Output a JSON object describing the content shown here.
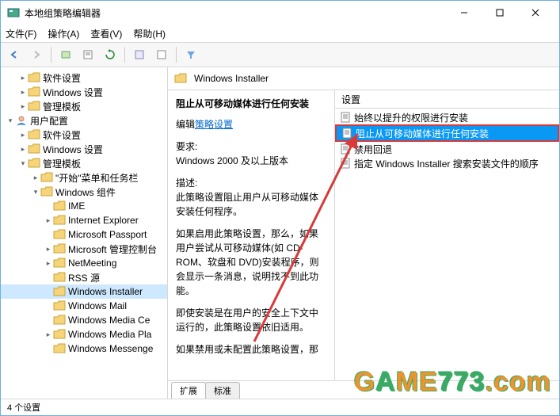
{
  "window": {
    "title": "本地组策略编辑器"
  },
  "menu": [
    "文件(F)",
    "操作(A)",
    "查看(V)",
    "帮助(H)"
  ],
  "tree": [
    {
      "d": 1,
      "exp": "r",
      "icon": "folder",
      "label": "软件设置"
    },
    {
      "d": 1,
      "exp": "r",
      "icon": "folder",
      "label": "Windows 设置"
    },
    {
      "d": 1,
      "exp": "r",
      "icon": "folder",
      "label": "管理模板"
    },
    {
      "d": 0,
      "exp": "d",
      "icon": "user",
      "label": "用户配置"
    },
    {
      "d": 1,
      "exp": "r",
      "icon": "folder",
      "label": "软件设置"
    },
    {
      "d": 1,
      "exp": "r",
      "icon": "folder",
      "label": "Windows 设置"
    },
    {
      "d": 1,
      "exp": "d",
      "icon": "folder",
      "label": "管理模板"
    },
    {
      "d": 2,
      "exp": "r",
      "icon": "folder",
      "label": "\"开始\"菜单和任务栏"
    },
    {
      "d": 2,
      "exp": "d",
      "icon": "folder",
      "label": "Windows 组件"
    },
    {
      "d": 3,
      "exp": "",
      "icon": "folder",
      "label": "IME"
    },
    {
      "d": 3,
      "exp": "r",
      "icon": "folder",
      "label": "Internet Explorer"
    },
    {
      "d": 3,
      "exp": "",
      "icon": "folder",
      "label": "Microsoft Passport"
    },
    {
      "d": 3,
      "exp": "r",
      "icon": "folder",
      "label": "Microsoft 管理控制台"
    },
    {
      "d": 3,
      "exp": "r",
      "icon": "folder",
      "label": "NetMeeting"
    },
    {
      "d": 3,
      "exp": "",
      "icon": "folder",
      "label": "RSS 源"
    },
    {
      "d": 3,
      "exp": "",
      "icon": "folder",
      "label": "Windows Installer",
      "sel": true
    },
    {
      "d": 3,
      "exp": "",
      "icon": "folder",
      "label": "Windows Mail"
    },
    {
      "d": 3,
      "exp": "",
      "icon": "folder",
      "label": "Windows Media Ce"
    },
    {
      "d": 3,
      "exp": "r",
      "icon": "folder",
      "label": "Windows Media Pla"
    },
    {
      "d": 3,
      "exp": "",
      "icon": "folder",
      "label": "Windows Messenge"
    }
  ],
  "rightHeader": "Windows Installer",
  "desc": {
    "title": "阻止从可移动媒体进行任何安装",
    "editPrefix": "编辑",
    "editLink": "策略设置",
    "reqLabel": "要求:",
    "reqText": "Windows 2000 及以上版本",
    "descLabel": "描述:",
    "p1": "此策略设置阻止用户从可移动媒体安装任何程序。",
    "p2": "如果启用此策略设置，那么，如果用户尝试从可移动媒体(如 CD-ROM、软盘和 DVD)安装程序，则会显示一条消息，说明找不到此功能。",
    "p3": "即使安装是在用户的安全上下文中运行的，此策略设置依旧适用。",
    "p4": "如果禁用或未配置此策略设置，那"
  },
  "listHeader": "设置",
  "listItems": [
    {
      "label": "始终以提升的权限进行安装"
    },
    {
      "label": "阻止从可移动媒体进行任何安装",
      "hl": true
    },
    {
      "label": "禁用回退"
    },
    {
      "label": "指定 Windows Installer 搜索安装文件的顺序"
    }
  ],
  "tabs": [
    "扩展",
    "标准"
  ],
  "status": "4 个设置"
}
